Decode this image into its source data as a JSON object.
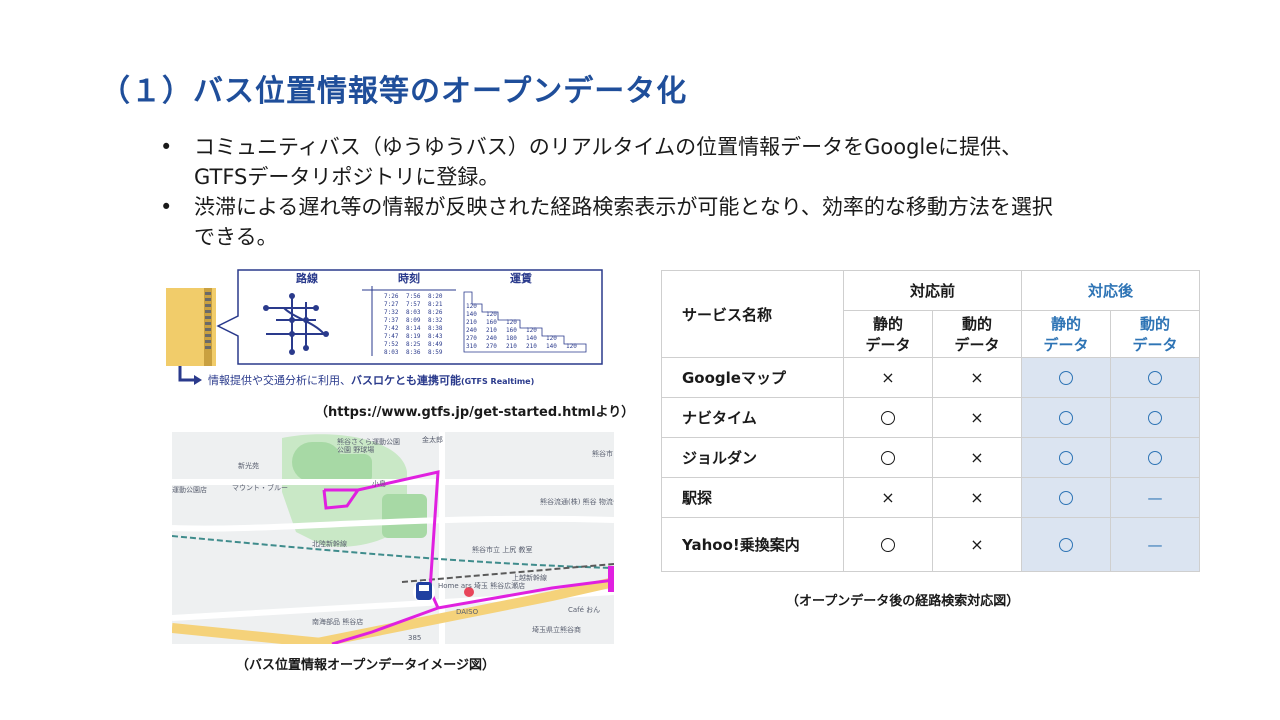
{
  "title": "（１）バス位置情報等のオープンデータ化",
  "bullets": [
    {
      "lines": [
        "コミュニティバス（ゆうゆうバス）のリアルタイムの位置情報データをGoogleに提供、",
        "GTFSデータリポジトリに登録。"
      ]
    },
    {
      "lines": [
        "渋滞による遅れ等の情報が反映された経路検索表示が可能となり、効率的な移動方法を選択",
        "できる。"
      ]
    }
  ],
  "gtfs_diagram": {
    "headers": [
      "路線",
      "時刻",
      "運賃"
    ],
    "times": [
      [
        "7:26",
        "7:56",
        "8:20"
      ],
      [
        "7:27",
        "7:57",
        "8:21"
      ],
      [
        "7:32",
        "8:03",
        "8:26"
      ],
      [
        "7:37",
        "8:09",
        "8:32"
      ],
      [
        "7:42",
        "8:14",
        "8:38"
      ],
      [
        "7:47",
        "8:19",
        "8:43"
      ],
      [
        "7:52",
        "8:25",
        "8:49"
      ],
      [
        "8:03",
        "8:36",
        "8:59"
      ]
    ],
    "fares": [
      [
        "120"
      ],
      [
        "140",
        "120"
      ],
      [
        "210",
        "160",
        "120"
      ],
      [
        "240",
        "210",
        "160",
        "120"
      ],
      [
        "270",
        "240",
        "180",
        "140",
        "120"
      ],
      [
        "310",
        "270",
        "210",
        "210",
        "140",
        "120"
      ]
    ],
    "bottom_text_prefix": "情報提供や交通分析に利用、",
    "bottom_text_emphasis": "バスロケとも連携可能",
    "bottom_text_suffix": "(GTFS Realtime)"
  },
  "caption_gtfs": "（https://www.gtfs.jp/get-started.htmlより）",
  "map": {
    "labels": {
      "park": "熊谷さくら運動公園",
      "park_ground": "公園 野球場",
      "shinkoji": "新光苑",
      "kintaro": "金太郎",
      "mount": "マウント・ブルー",
      "undo_koen": "運動公園店",
      "kojima": "小島",
      "kumagaya": "熊谷市",
      "butsuryu": "熊谷流通(株) 熊谷 物流センター",
      "shinkansen": "上越新幹線",
      "hokuriku": "北陸新幹線",
      "cafe": "Café おん",
      "store": "Home ars 埼玉 熊谷広瀬店",
      "daiso": "DAISO",
      "school": "熊谷市立 上尻 教室",
      "nankaibu": "南海部品 熊谷店",
      "kenritsu": "埼玉県立熊谷商",
      "road": "385"
    }
  },
  "caption_map": "（バス位置情報オープンデータイメージ図）",
  "table": {
    "service_header": "サービス名称",
    "before_header": "対応前",
    "after_header": "対応後",
    "static_line1": "静的",
    "dynamic_line1": "動的",
    "line2": "データ",
    "rows": [
      {
        "name": "Googleマップ",
        "cells": [
          "x",
          "x",
          "o",
          "o"
        ]
      },
      {
        "name": "ナビタイム",
        "cells": [
          "o",
          "x",
          "o",
          "o"
        ]
      },
      {
        "name": "ジョルダン",
        "cells": [
          "o",
          "x",
          "o",
          "o"
        ]
      },
      {
        "name": "駅探",
        "cells": [
          "x",
          "x",
          "o",
          "-"
        ]
      },
      {
        "name": "Yahoo!乗換案内",
        "cells": [
          "o",
          "x",
          "o",
          "-"
        ]
      }
    ],
    "symbols": {
      "x": "×",
      "-": "—"
    }
  },
  "caption_table": "（オープンデータ後の経路検索対応図）",
  "colors": {
    "title": "#1f4e9a",
    "after_bg": "#dbe4f1",
    "after_text": "#2e74b5",
    "map_route": "#e020e0"
  }
}
